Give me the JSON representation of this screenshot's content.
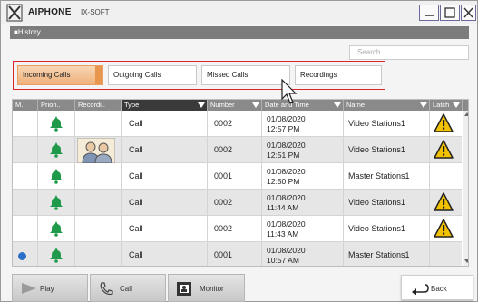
{
  "app": {
    "brand": "AIPHONE",
    "product": "IX-SOFT",
    "section": "■History"
  },
  "search": {
    "placeholder": "Search..."
  },
  "tabs": [
    {
      "label": "Incoming Calls",
      "active": true
    },
    {
      "label": "Outgoing Calls",
      "active": false
    },
    {
      "label": "Missed Calls",
      "active": false
    },
    {
      "label": "Recordings",
      "active": false
    }
  ],
  "table": {
    "columns": [
      "M..",
      "Priori..",
      "Recordi..",
      "Type",
      "Number",
      "Date and Time",
      "Name",
      "Latch"
    ],
    "rows": [
      {
        "marked": false,
        "priority": "bell",
        "recording": false,
        "type": "Call",
        "number": "0002",
        "date": "01/08/2020",
        "time": "12:57 PM",
        "name": "Video Stations1",
        "latch": true
      },
      {
        "marked": false,
        "priority": "bell",
        "recording": true,
        "type": "Call",
        "number": "0002",
        "date": "01/08/2020",
        "time": "12:51 PM",
        "name": "Video Stations1",
        "latch": true
      },
      {
        "marked": false,
        "priority": "bell",
        "recording": false,
        "type": "Call",
        "number": "0001",
        "date": "01/08/2020",
        "time": "12:50 PM",
        "name": "Master Stations1",
        "latch": false
      },
      {
        "marked": false,
        "priority": "bell",
        "recording": false,
        "type": "Call",
        "number": "0002",
        "date": "01/08/2020",
        "time": "11:44 AM",
        "name": "Video Stations1",
        "latch": true
      },
      {
        "marked": false,
        "priority": "bell",
        "recording": false,
        "type": "Call",
        "number": "0002",
        "date": "01/08/2020",
        "time": "11:43 AM",
        "name": "Video Stations1",
        "latch": true
      },
      {
        "marked": true,
        "priority": "bell",
        "recording": false,
        "type": "Call",
        "number": "0001",
        "date": "01/08/2020",
        "time": "10:57 AM",
        "name": "Master Stations1",
        "latch": false
      }
    ]
  },
  "buttons": {
    "play": "Play",
    "call": "Call",
    "monitor": "Monitor",
    "back": "Back"
  },
  "colors": {
    "bell": "#1f9a4a",
    "warning": "#f2c200",
    "active_tab": "#f0b07a",
    "highlight": "#d9262b",
    "marker": "#2c6fc7"
  }
}
